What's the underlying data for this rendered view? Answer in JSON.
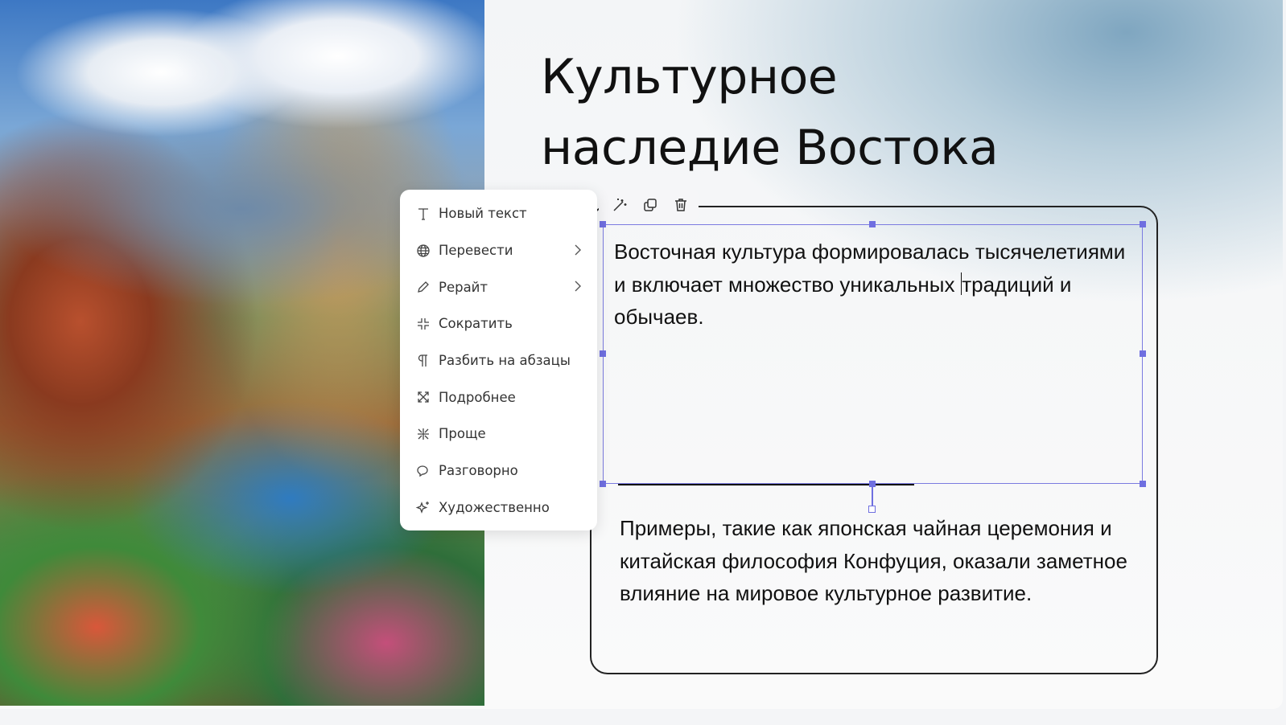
{
  "slide": {
    "title": "Культурное наследие Востока",
    "paragraph1_before_caret": "Восточная культура формировалась тысячелетиями и включает множество уникальных ",
    "paragraph1_after_caret": "традиций и обычаев.",
    "paragraph2": "Примеры, такие как японская чайная церемония и китайская философия Конфуция, оказали заметное влияние на мировое культурное развитие."
  },
  "toolbar": {
    "icons": [
      "magic-wand-icon",
      "duplicate-icon",
      "trash-icon"
    ]
  },
  "menu": {
    "items": [
      {
        "label": "Новый текст",
        "icon": "text-icon"
      },
      {
        "label": "Перевести",
        "icon": "globe-icon",
        "submenu": true
      },
      {
        "label": "Рерайт",
        "icon": "pencil-icon",
        "submenu": true
      },
      {
        "label": "Сократить",
        "icon": "shrink-icon"
      },
      {
        "label": "Разбить на абзацы",
        "icon": "pilcrow-icon"
      },
      {
        "label": "Подробнее",
        "icon": "expand-icon"
      },
      {
        "label": "Проще",
        "icon": "collapse-icon"
      },
      {
        "label": "Разговорно",
        "icon": "chat-icon"
      },
      {
        "label": "Художественно",
        "icon": "sparkle-icon"
      }
    ]
  },
  "colors": {
    "selection": "#6f6fe0"
  }
}
